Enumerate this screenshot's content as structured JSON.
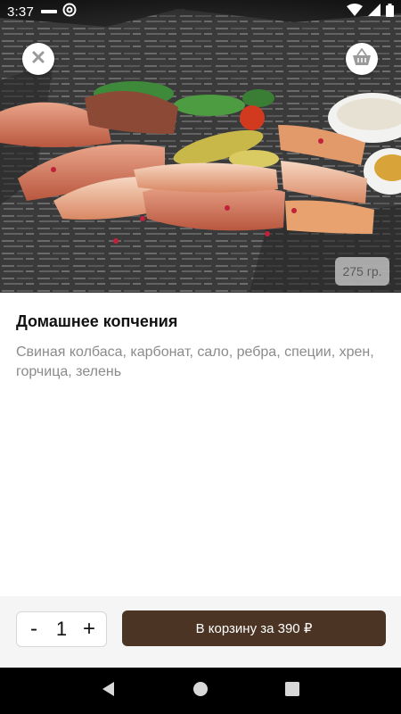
{
  "status_bar": {
    "time": "3:37",
    "icons": [
      "notification-icon",
      "at-sign-icon",
      "wifi-icon",
      "signal-icon",
      "battery-icon"
    ]
  },
  "hero": {
    "image": "smoked-meats-platter",
    "weight": "275 гр."
  },
  "product": {
    "title": "Домашнее копчения",
    "description": "Свиная колбаса, карбонат, сало, ребра, специи, хрен, горчица, зелень"
  },
  "stepper": {
    "minus": "-",
    "quantity": "1",
    "plus": "+"
  },
  "cart_button": {
    "label": "В корзину за 390 ₽"
  },
  "colors": {
    "accent": "#4b3423",
    "description": "#8b8b8b",
    "bottom_bar": "#f5f5f5"
  },
  "nav_bar": {
    "icons": [
      "back-icon",
      "home-icon",
      "recents-icon"
    ]
  }
}
